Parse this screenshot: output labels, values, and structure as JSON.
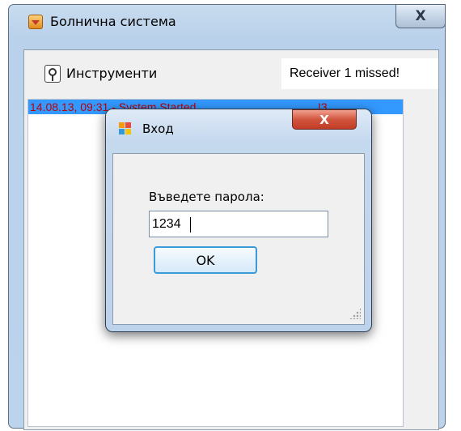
{
  "main_window": {
    "title": "Болнична система",
    "close_label": "X",
    "menu": {
      "tools_label": "Инструменти"
    },
    "status_text": "Receiver 1 missed!",
    "log": [
      {
        "text": "14.08.13, 09:31 - System Started",
        "code": "!3"
      }
    ]
  },
  "dialog": {
    "title": "Вход",
    "close_label": "X",
    "prompt": "Въведете парола:",
    "password_value": "1234",
    "ok_label": "OK"
  }
}
